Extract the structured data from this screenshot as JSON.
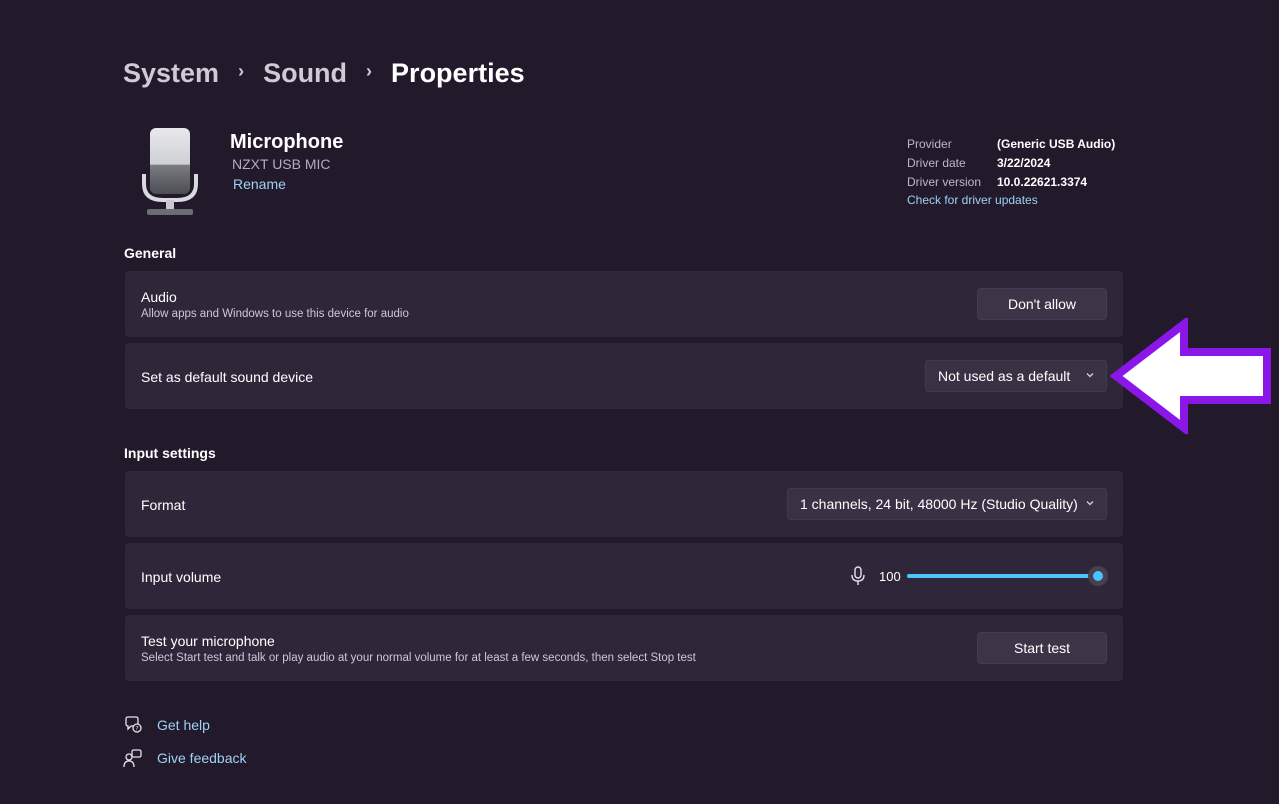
{
  "breadcrumb": {
    "items": [
      "System",
      "Sound",
      "Properties"
    ]
  },
  "device": {
    "name": "Microphone",
    "model": "NZXT USB MIC",
    "rename_label": "Rename",
    "icon": "microphone-device-icon"
  },
  "driver": {
    "rows": [
      {
        "label": "Provider",
        "value": "(Generic USB Audio)"
      },
      {
        "label": "Driver date",
        "value": "3/22/2024"
      },
      {
        "label": "Driver version",
        "value": "10.0.22621.3374"
      }
    ],
    "update_link": "Check for driver updates"
  },
  "general": {
    "title": "General",
    "audio": {
      "title": "Audio",
      "description": "Allow apps and Windows to use this device for audio",
      "button_label": "Don't allow"
    },
    "default_device": {
      "title": "Set as default sound device",
      "selected": "Not used as a default"
    }
  },
  "input_settings": {
    "title": "Input settings",
    "format": {
      "title": "Format",
      "selected": "1 channels, 24 bit, 48000 Hz (Studio Quality)"
    },
    "volume": {
      "title": "Input volume",
      "value": "100",
      "level": 1.0
    },
    "test": {
      "title": "Test your microphone",
      "description": "Select Start test and talk or play audio at your normal volume for at least a few seconds, then select Stop test",
      "button_label": "Start test"
    }
  },
  "footer": {
    "get_help": "Get help",
    "give_feedback": "Give feedback"
  },
  "colors": {
    "background": "#22192b",
    "card": "#2f2739",
    "accent": "#4cc2ff",
    "link": "#9fd1f6",
    "annotation_arrow": "#8a16e8"
  }
}
